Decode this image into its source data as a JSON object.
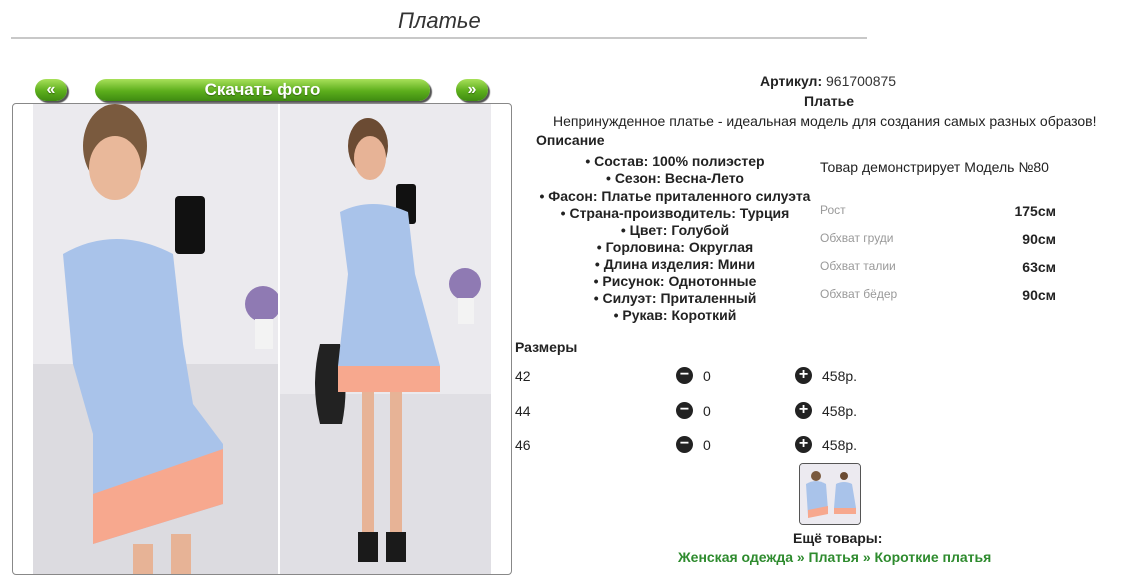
{
  "page_title": "Платье",
  "nav": {
    "prev_label": "«",
    "next_label": "»",
    "download_label": "Скачать фото"
  },
  "product": {
    "article_label": "Артикул:",
    "article_value": "961700875",
    "name": "Платье",
    "tagline": "Непринужденное платье - идеальная модель для создания самых разных образов!",
    "description_heading": "Описание",
    "specs": [
      "• Состав: 100% полиэстер",
      "• Сезон: Весна-Лето",
      "• Фасон: Платье приталенного силуэта",
      "• Страна-производитель: Турция",
      "• Цвет: Голубой",
      "• Горловина: Округлая",
      "• Длина изделия: Мини",
      "• Рисунок: Однотонные",
      "• Силуэт: Приталенный",
      "• Рукав: Короткий"
    ]
  },
  "model": {
    "line": "Товар демонстрирует Модель №80",
    "measurements": [
      {
        "label": "Рост",
        "value": "175см"
      },
      {
        "label": "Обхват груди",
        "value": "90см"
      },
      {
        "label": "Обхват талии",
        "value": "63см"
      },
      {
        "label": "Обхват бёдер",
        "value": "90см"
      }
    ]
  },
  "sizes": {
    "heading": "Размеры",
    "rows": [
      {
        "size": "42",
        "qty": "0",
        "price": "458р."
      },
      {
        "size": "44",
        "qty": "0",
        "price": "458р."
      },
      {
        "size": "46",
        "qty": "0",
        "price": "458р."
      }
    ]
  },
  "more": {
    "heading": "Ещё товары:",
    "breadcrumb_partial": "Женская одежда » Платья » Короткие платья"
  },
  "colors": {
    "accent_green": "#5cae1c",
    "dress_blue": "#a9c3ea",
    "dress_hem": "#f7a88e"
  }
}
